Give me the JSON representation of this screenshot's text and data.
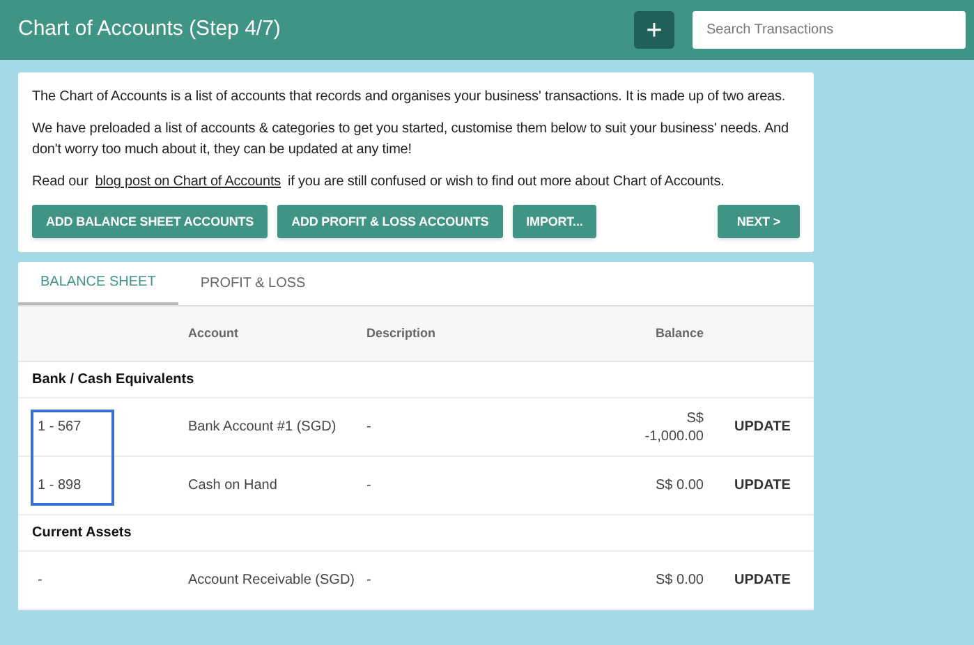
{
  "header": {
    "title": "Chart of Accounts (Step 4/7)",
    "add_button": "+",
    "search": {
      "placeholder": "Search Transactions"
    }
  },
  "intro": {
    "paragraphs": [
      "The Chart of Accounts is a list of accounts that records and organises your business' transactions. It is made up of two areas.",
      "We have preloaded a list of accounts & categories to get you started, customise them below to suit your business' needs. And don't worry too much about it, they can be updated at any time!"
    ],
    "read_more": {
      "before": "Read our",
      "link": "blog post on Chart of Accounts",
      "after": "if you are still confused or wish to find out more about Chart of Accounts."
    },
    "buttons": [
      "ADD BALANCE SHEET ACCOUNTS",
      "ADD PROFIT & LOSS ACCOUNTS",
      "IMPORT..."
    ],
    "next_button": "NEXT >"
  },
  "tabs": [
    {
      "label": "BALANCE SHEET",
      "selected": true
    },
    {
      "label": "PROFIT & LOSS",
      "selected": false
    }
  ],
  "table": {
    "columns": [
      "Account",
      "Description",
      "Balance"
    ],
    "rows": [
      {
        "kind": "group",
        "name": "Bank / Cash Equivalents"
      },
      {
        "kind": "account",
        "code": "1 - 567",
        "account": "Bank Account #1 (SGD)",
        "description": "-",
        "balance": [
          "S$",
          "-1,000.00"
        ],
        "action": "UPDATE",
        "highlighted": true
      },
      {
        "kind": "account",
        "code": "1 - 898",
        "account": "Cash on Hand",
        "description": "-",
        "balance": [
          "S$ 0.00"
        ],
        "action": "UPDATE",
        "highlighted": true
      },
      {
        "kind": "group",
        "name": "Current Assets"
      },
      {
        "kind": "account",
        "code": "-",
        "account": "Account Receivable (SGD)",
        "description": "-",
        "balance": [
          "S$ 0.00"
        ],
        "action": "UPDATE",
        "highlighted": false
      }
    ]
  }
}
